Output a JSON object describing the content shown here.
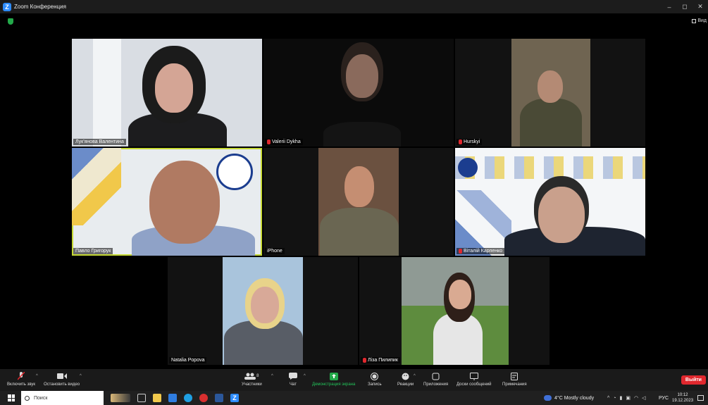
{
  "window": {
    "title": "Zoom Конференция",
    "minimize": "–",
    "maximize": "◻",
    "close": "✕"
  },
  "view": {
    "label": "Вид"
  },
  "participants": [
    {
      "name": "Лук'янова Валентина",
      "muted": false
    },
    {
      "name": "Valerii Dykha",
      "muted": true
    },
    {
      "name": "Hurskyi",
      "muted": true
    },
    {
      "name": "Павло Григорук",
      "muted": false,
      "active": true
    },
    {
      "name": "iPhone",
      "muted": false
    },
    {
      "name": "Віталій Карпенко",
      "muted": true
    },
    {
      "name": "Natalia Popova",
      "muted": false
    },
    {
      "name": "Ліза Пилипик",
      "muted": true
    }
  ],
  "toolbar": {
    "audio": "Включить звук",
    "video": "Остановить видео",
    "participants": "Участники",
    "participants_count": "8",
    "chat": "Чат",
    "share": "Демонстрация экрана",
    "record": "Запись",
    "reactions": "Реакции",
    "apps": "Приложения",
    "whiteboards": "Доски сообщений",
    "notes": "Примечания",
    "leave": "Выйти"
  },
  "taskbar": {
    "search_placeholder": "Поиск",
    "weather": "4°C Mostly cloudy",
    "language": "РУС",
    "time": "10:12",
    "date": "19.12.2023"
  },
  "colors": {
    "accent": "#2d8cff",
    "active_speaker": "#c6d934",
    "share": "#23a94a",
    "leave": "#e0282e"
  }
}
